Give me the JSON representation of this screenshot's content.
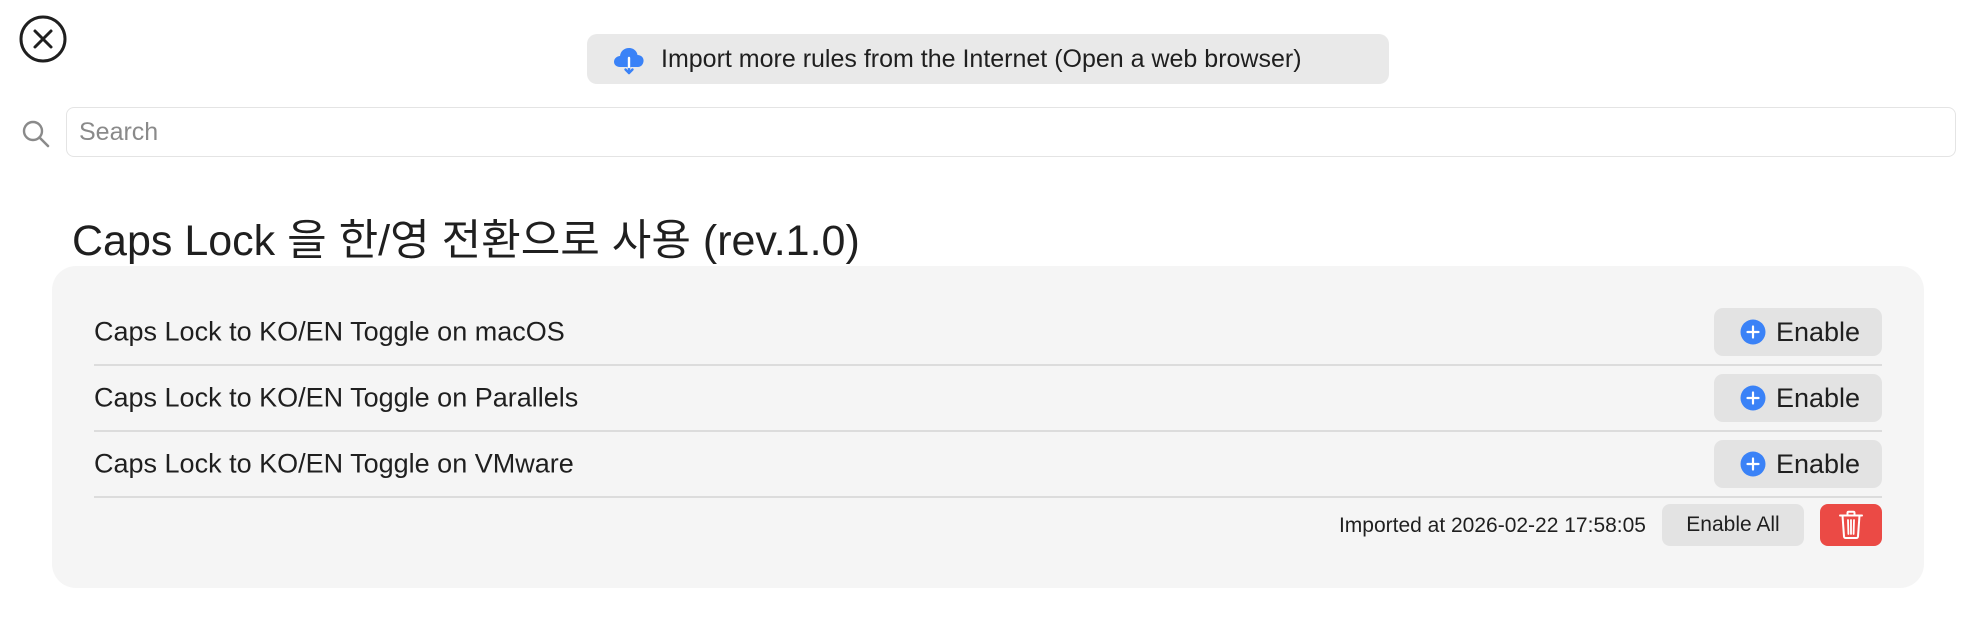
{
  "header": {
    "close_icon": "close-circle-icon",
    "import_button": {
      "icon": "cloud-download-icon",
      "label": "Import more rules from the Internet (Open a web browser)"
    }
  },
  "search": {
    "icon": "magnifying-glass-icon",
    "placeholder": "Search",
    "value": ""
  },
  "group": {
    "title": "Caps Lock 을 한/영 전환으로 사용 (rev.1.0)",
    "rules": [
      {
        "label": "Caps Lock to KO/EN Toggle on macOS",
        "button_label": "Enable"
      },
      {
        "label": "Caps Lock to KO/EN Toggle on Parallels",
        "button_label": "Enable"
      },
      {
        "label": "Caps Lock to KO/EN Toggle on VMware",
        "button_label": "Enable"
      }
    ],
    "imported_at": "Imported at 2026-02-22 17:58:05",
    "enable_all_label": "Enable All",
    "delete_icon": "trash-icon"
  },
  "colors": {
    "accent": "#3a82f7",
    "delete": "#eb4a45",
    "button_bg": "#e3e3e3",
    "card_bg": "#f5f5f5"
  }
}
